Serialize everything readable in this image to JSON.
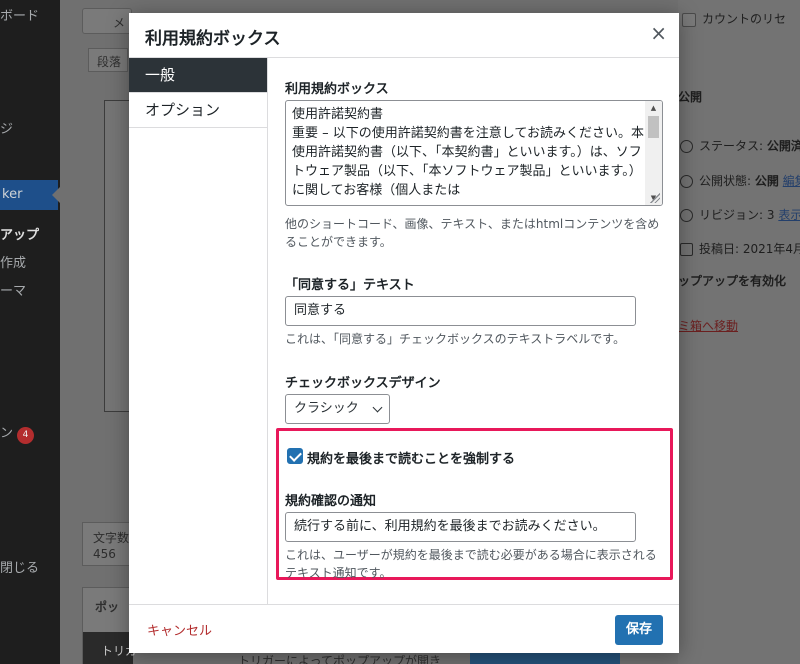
{
  "background": {
    "sidebar": {
      "items": [
        {
          "label": "ボード"
        },
        {
          "label": "ジ"
        },
        {
          "label": "ker"
        },
        {
          "label": "アップ"
        },
        {
          "label": "作成"
        },
        {
          "label": "ーマ"
        },
        {
          "label": "ン",
          "badge": "4"
        },
        {
          "label": "閉じる"
        }
      ]
    },
    "editor": {
      "toolbar_button": "メ",
      "format_label": "段落",
      "word_count_label": "文字数",
      "word_count_value": "456",
      "popup_section": "ポッ",
      "trigger_tab": "トリガ",
      "trigger_hint": "トリガーによってポップアップが開き"
    },
    "right_panel": {
      "count_reset": "カウントのリセ",
      "publish_title": "公開",
      "status_label": "ステータス:",
      "status_value": "公開済",
      "visibility_label": "公開状態:",
      "visibility_value": "公開",
      "visibility_link": "編集",
      "revisions_label": "リビジョン: 3",
      "revisions_link": "表示",
      "published_on": "投稿日: 2021年4月",
      "enable_popup": "ップアップを有効化",
      "trash_link": "ミ箱へ移動"
    }
  },
  "modal": {
    "title": "利用規約ボックス",
    "close_icon": "×",
    "tabs": [
      {
        "label": "一般",
        "active": true
      },
      {
        "label": "オプション",
        "active": false
      }
    ],
    "terms_box": {
      "label": "利用規約ボックス",
      "content": "使用許諾契約書\n重要 – 以下の使用許諾契約書を注意してお読みください。本使用許諾契約書（以下、「本契約書」といいます。）は、ソフトウェア製品（以下、「本ソフトウェア製品」といいます。）に関してお客様（個人または",
      "description": "他のショートコード、画像、テキスト、またはhtmlコンテンツを含めることができます。"
    },
    "agree_text": {
      "label": "「同意する」テキスト",
      "value": "同意する",
      "description": "これは、「同意する」チェックボックスのテキストラベルです。"
    },
    "checkbox_design": {
      "label": "チェックボックスデザイン",
      "selected": "クラシック"
    },
    "force_read": {
      "label": "規約を最後まで読むことを強制する",
      "checked": true
    },
    "notice": {
      "label": "規約確認の通知",
      "value": "続行する前に、利用規約を最後までお読みください。",
      "description": "これは、ユーザーが規約を最後まで読む必要がある場合に表示されるテキスト通知です。"
    },
    "highlight_color": "#e8185a",
    "footer": {
      "cancel_label": "キャンセル",
      "save_label": "保存"
    }
  }
}
